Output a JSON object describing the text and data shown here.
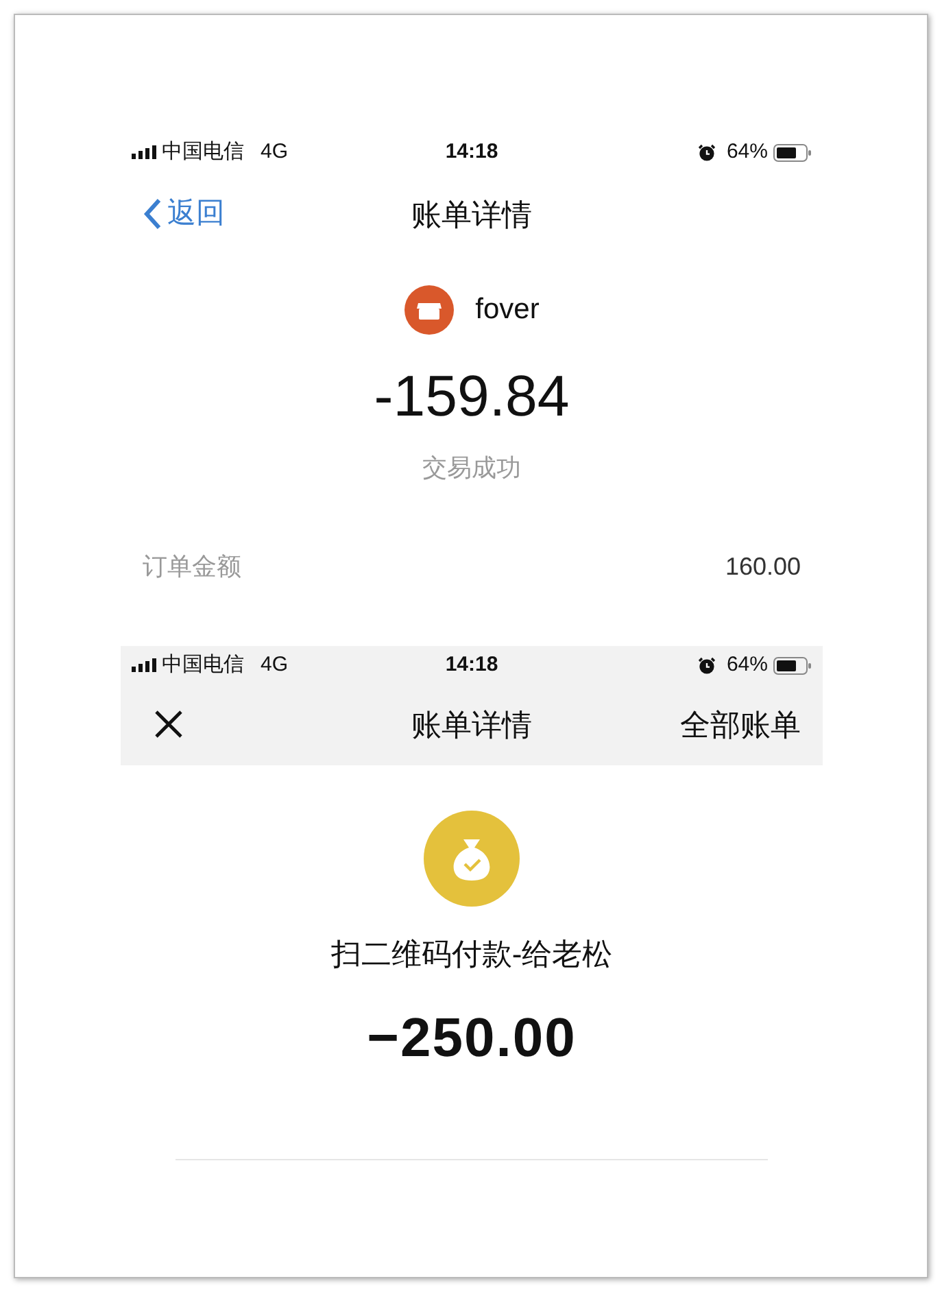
{
  "screens": [
    {
      "status_bar": {
        "carrier": "中国电信",
        "network": "4G",
        "time": "14:18",
        "battery": "64%"
      },
      "nav": {
        "back": "返回",
        "title": "账单详情"
      },
      "merchant": "fover",
      "amount": "-159.84",
      "status": "交易成功",
      "rows": [
        {
          "label": "订单金额",
          "value": "160.00"
        }
      ]
    },
    {
      "status_bar": {
        "carrier": "中国电信",
        "network": "4G",
        "time": "14:18",
        "battery": "64%"
      },
      "nav": {
        "title": "账单详情",
        "action": "全部账单"
      },
      "payee": "扫二维码付款-给老松",
      "amount": "−250.00"
    }
  ]
}
